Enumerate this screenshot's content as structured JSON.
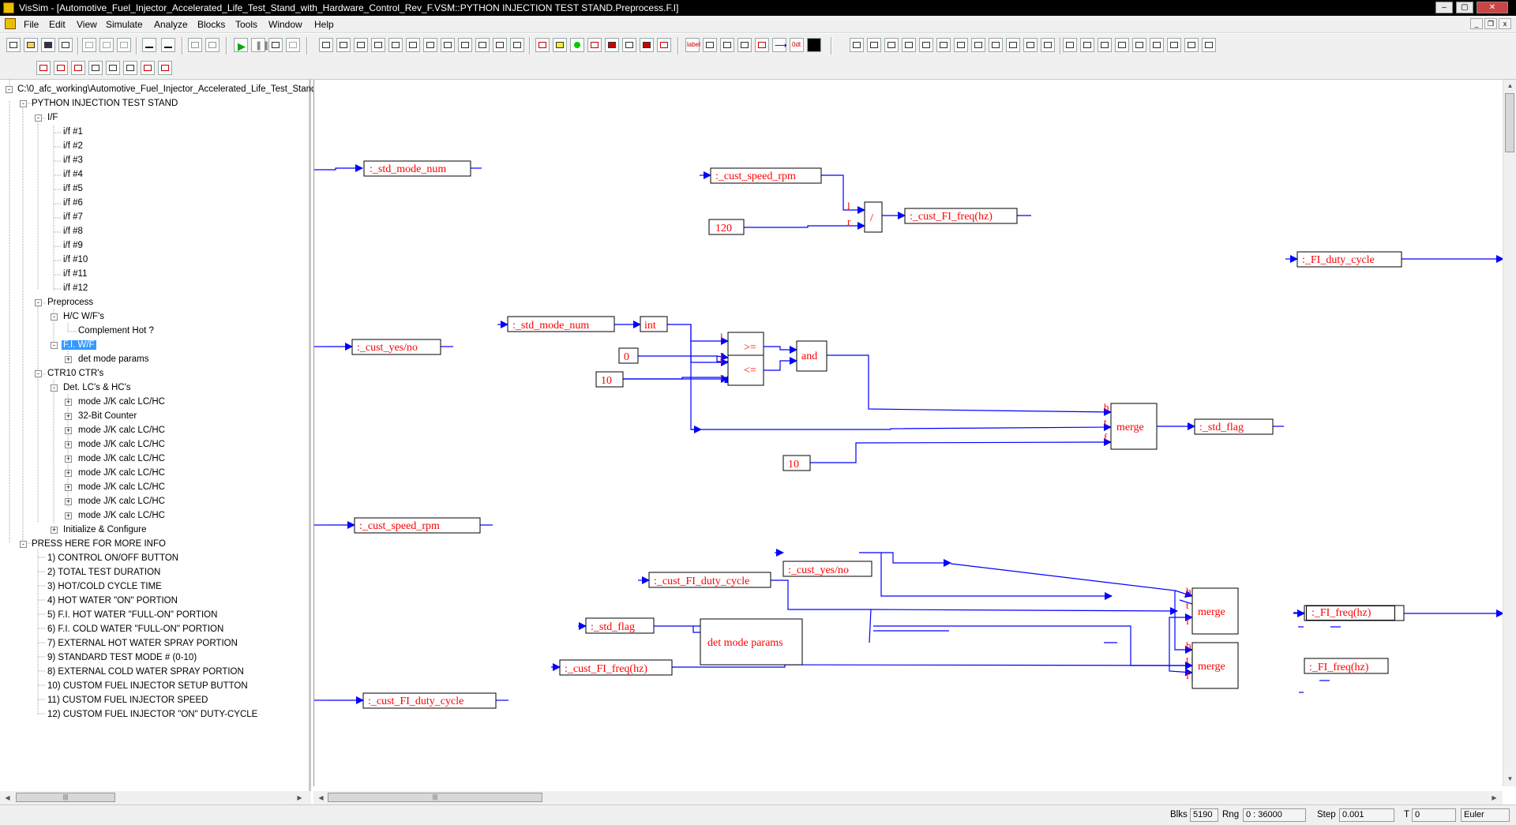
{
  "window": {
    "title": "VisSim - [Automotive_Fuel_Injector_Accelerated_Life_Test_Stand_with_Hardware_Control_Rev_F.VSM::PYTHON INJECTION TEST STAND.Preprocess.F.I]"
  },
  "menu": [
    "File",
    "Edit",
    "View",
    "Simulate",
    "Analyze",
    "Blocks",
    "Tools",
    "Window",
    "Help"
  ],
  "toolbar": {
    "label_btn": "label",
    "odt_btn": "0dt"
  },
  "tree": {
    "root": "C:\\0_afc_working\\Automotive_Fuel_Injector_Accelerated_Life_Test_Stand_with_Hardware_Control_Rev_F.vsm",
    "stand": "PYTHON INJECTION TEST STAND",
    "if_folder": "I/F",
    "if_items": [
      "i/f #1",
      "i/f #2",
      "i/f #3",
      "i/f #4",
      "i/f #5",
      "i/f #6",
      "i/f #7",
      "i/f #8",
      "i/f #9",
      "i/f #10",
      "i/f #11",
      "i/f #12"
    ],
    "preprocess": "Preprocess",
    "hc_wfs": "H/C W/F's",
    "complement_hot": "Complement Hot ?",
    "fi_wf": "F.I. W/F",
    "det_mode_params": "det mode params",
    "ctr10": "CTR10 CTR's",
    "det_lcs": "Det. LC's & HC's",
    "ctr_items": [
      "mode J/K calc LC/HC",
      "32-Bit Counter",
      "mode J/K calc LC/HC",
      "mode J/K calc LC/HC",
      "mode J/K calc LC/HC",
      "mode J/K calc LC/HC",
      "mode J/K calc LC/HC",
      "mode J/K calc LC/HC",
      "mode J/K calc LC/HC"
    ],
    "init_config": "Initialize & Configure",
    "more_info": "PRESS HERE FOR MORE INFO",
    "info_items": [
      "1) CONTROL ON/OFF BUTTON",
      "2) TOTAL TEST DURATION",
      "3) HOT/COLD CYCLE TIME",
      "4) HOT WATER \"ON\" PORTION",
      "5) F.I. HOT WATER \"FULL-ON\" PORTION",
      "6) F.I. COLD WATER \"FULL-ON\" PORTION",
      "7) EXTERNAL HOT WATER SPRAY PORTION",
      "9) STANDARD TEST MODE # (0-10)",
      "8) EXTERNAL COLD WATER SPRAY PORTION",
      "10) CUSTOM FUEL INJECTOR SETUP BUTTON",
      "11) CUSTOM FUEL INJECTOR SPEED",
      "12) CUSTOM FUEL INJECTOR \"ON\" DUTY-CYCLE"
    ]
  },
  "diagram": {
    "vars": {
      "std_mode_num": ":_std_mode_num",
      "cust_speed_rpm": ":_cust_speed_rpm",
      "cust_fi_freq": ":_cust_FI_freq(hz)",
      "fi_duty_cycle": ":_FI_duty_cycle",
      "cust_yes_no": ":_cust_yes/no",
      "std_flag": ":_std_flag",
      "cust_fi_duty_cycle": ":_cust_FI_duty_cycle",
      "fi_freq": ":_FI_freq(hz)"
    },
    "const_120": "120",
    "const_0": "0",
    "const_10": "10",
    "divide": "/",
    "int_block": "int",
    "ge": ">=",
    "le": "<=",
    "and_block": "and",
    "merge": "merge",
    "det_mode_params": "det mode params",
    "port_l": "l",
    "port_r": "r",
    "port_b": "b",
    "port_t": "t",
    "port_f": "f"
  },
  "status": {
    "blks_label": "Blks",
    "blks_value": "5190",
    "rng_label": "Rng",
    "rng_value": "0 : 36000",
    "step_label": "Step",
    "step_value": "0.001",
    "t_label": "T",
    "t_value": "0",
    "integrator": "Euler"
  },
  "colors": {
    "wire": "#0000ff",
    "label": "#ff0000",
    "selection": "#3399ff"
  }
}
